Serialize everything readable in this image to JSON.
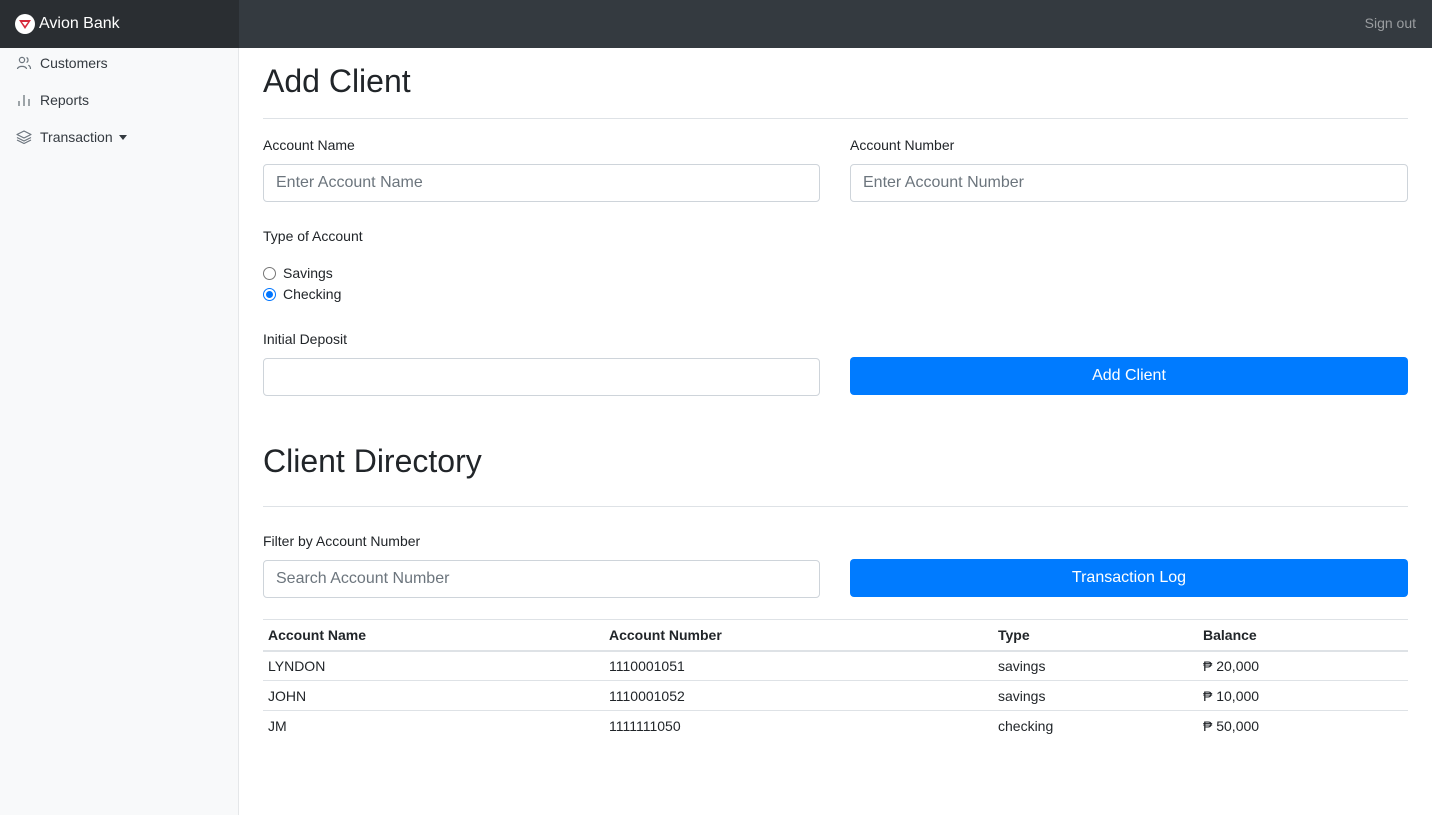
{
  "navbar": {
    "brand": "Avion Bank",
    "signout": "Sign out"
  },
  "sidebar": {
    "items": [
      {
        "label": "Customers",
        "icon": "users-icon"
      },
      {
        "label": "Reports",
        "icon": "bar-chart-icon"
      },
      {
        "label": "Transaction",
        "icon": "layers-icon"
      }
    ]
  },
  "add_client": {
    "title": "Add Client",
    "account_name_label": "Account Name",
    "account_name_placeholder": "Enter Account Name",
    "account_number_label": "Account Number",
    "account_number_placeholder": "Enter Account Number",
    "type_label": "Type of Account",
    "type_options": [
      "Savings",
      "Checking"
    ],
    "type_selected": "Checking",
    "deposit_label": "Initial Deposit",
    "deposit_value": "",
    "submit_label": "Add Client"
  },
  "directory": {
    "title": "Client Directory",
    "filter_label": "Filter by Account Number",
    "filter_placeholder": "Search Account Number",
    "log_button": "Transaction Log",
    "columns": [
      "Account Name",
      "Account Number",
      "Type",
      "Balance"
    ],
    "rows": [
      {
        "name": "LYNDON",
        "number": "1110001051",
        "type": "savings",
        "balance": "₱ 20,000"
      },
      {
        "name": "JOHN",
        "number": "1110001052",
        "type": "savings",
        "balance": "₱ 10,000"
      },
      {
        "name": "JM",
        "number": "1111111050",
        "type": "checking",
        "balance": "₱ 50,000"
      }
    ]
  },
  "colors": {
    "primary": "#007bff",
    "navbar": "#343a40",
    "sidebar": "#f8f9fa"
  }
}
